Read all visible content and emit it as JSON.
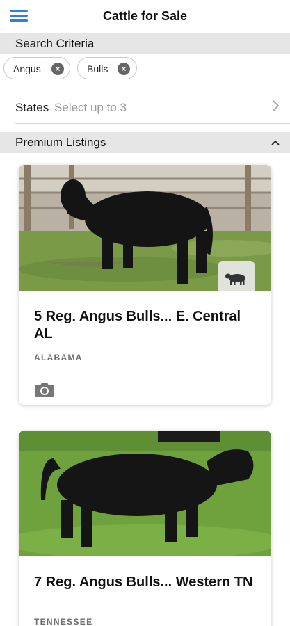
{
  "header": {
    "title": "Cattle for Sale"
  },
  "search": {
    "heading": "Search Criteria",
    "chips": [
      {
        "label": "Angus"
      },
      {
        "label": "Bulls"
      }
    ],
    "states_label": "States",
    "states_placeholder": "Select up to 3"
  },
  "premium": {
    "heading": "Premium Listings",
    "listings": [
      {
        "title": "5 Reg. Angus Bulls... E. Central AL",
        "state": "ALABAMA"
      },
      {
        "title": "7 Reg. Angus Bulls... Western TN",
        "state": "TENNESSEE"
      }
    ]
  },
  "colors": {
    "accent": "#2f7fe0",
    "section_bg": "#e6e6e6",
    "muted_text": "#9a9a9a"
  },
  "icons": {
    "menu": "hamburger-menu-icon",
    "chip_remove": "close-circle-icon",
    "states_chevron": "chevron-right-icon",
    "collapse": "chevron-up-icon",
    "photos": "camera-icon",
    "category": "bull-silhouette-icon"
  }
}
